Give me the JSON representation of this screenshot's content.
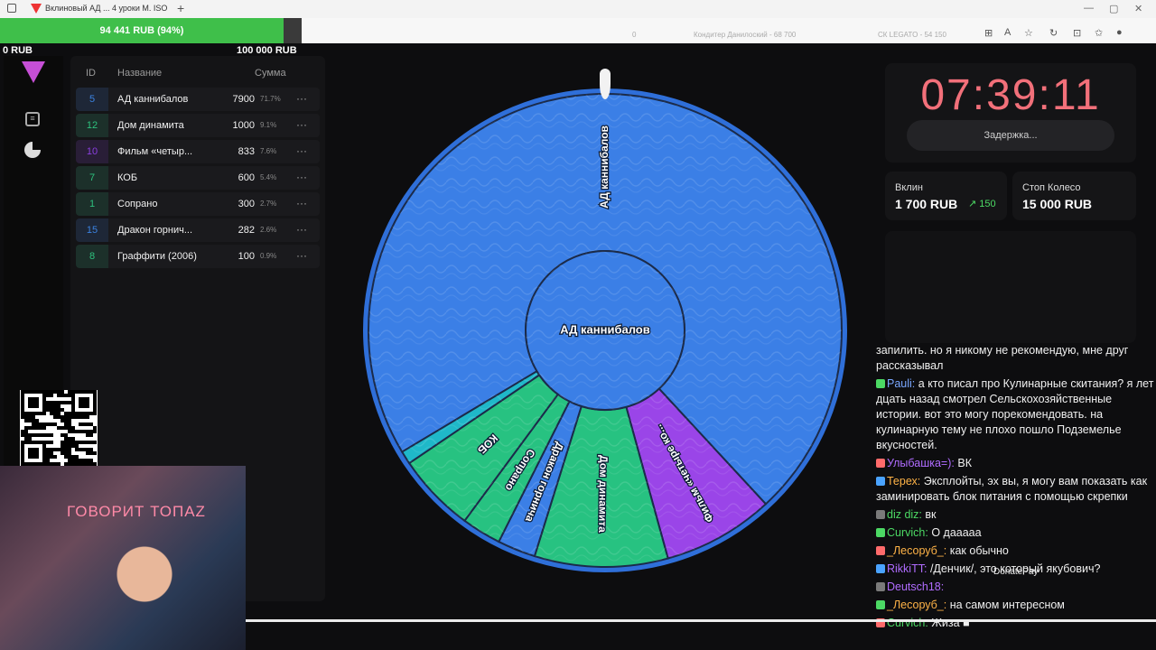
{
  "browser": {
    "title": "Вклиновый АД ... 4 уроки М. ISO",
    "plus": "+",
    "address_items": [
      "0",
      "Кондитер Данилоский - 68 700",
      "СК LEGATO - 54 150"
    ]
  },
  "goal": {
    "current_label": "94 441 RUB (94%)",
    "min_label": "0 RUB",
    "max_label": "100 000 RUB",
    "progress": 0.94
  },
  "sidebar": {
    "list_icon": "list-icon",
    "pie_icon": "pie-chart-icon",
    "logo": "logo-triangle-icon"
  },
  "table": {
    "headers": {
      "id": "ID",
      "name": "Название",
      "sum": "Сумма"
    },
    "rows": [
      {
        "id": "5",
        "name": "АД каннибалов",
        "sum": "7900",
        "pct": "71.7%",
        "color": "#3b82e0"
      },
      {
        "id": "12",
        "name": "Дом динамита",
        "sum": "1000",
        "pct": "9.1%",
        "color": "#2ec27e"
      },
      {
        "id": "10",
        "name": "Фильм «четыр...",
        "sum": "833",
        "pct": "7.6%",
        "color": "#8b3fe0"
      },
      {
        "id": "7",
        "name": "КОБ",
        "sum": "600",
        "pct": "5.4%",
        "color": "#2ec27e"
      },
      {
        "id": "1",
        "name": "Сопрано",
        "sum": "300",
        "pct": "2.7%",
        "color": "#2ec27e"
      },
      {
        "id": "15",
        "name": "Дракон горнич...",
        "sum": "282",
        "pct": "2.6%",
        "color": "#3b82e0"
      },
      {
        "id": "8",
        "name": "Граффити (2006)",
        "sum": "100",
        "pct": "0.9%",
        "color": "#2ec27e"
      }
    ],
    "more": "···"
  },
  "wheel": {
    "center_label": "АД каннибалов",
    "segments": [
      {
        "label": "АД каннибалов",
        "share": 0.717,
        "color": "#3b7fe6"
      },
      {
        "label": "Фильм «четыре ко...",
        "share": 0.076,
        "color": "#9a45e8"
      },
      {
        "label": "Дом динамита",
        "share": 0.091,
        "color": "#27c281"
      },
      {
        "label": "Дракон горнича",
        "share": 0.026,
        "color": "#3b7fe6"
      },
      {
        "label": "Сопрано",
        "share": 0.027,
        "color": "#27c281"
      },
      {
        "label": "КОБ",
        "share": 0.054,
        "color": "#27c281"
      },
      {
        "label": "",
        "share": 0.009,
        "color": "#1fb8c9"
      }
    ]
  },
  "timer": {
    "value": "07:39:11",
    "delay_label": "Задержка..."
  },
  "stats": {
    "insert": {
      "label": "Вклин",
      "value": "1 700 RUB",
      "delta": "150"
    },
    "stop": {
      "label": "Стоп Колесо",
      "value": "15 000 RUB"
    }
  },
  "chat": [
    {
      "user": "",
      "user_color": "#ffffff",
      "text": "запилить. но я никому не рекомендую, мне друг рассказывал"
    },
    {
      "user": "Pauli:",
      "user_color": "#7aa7ff",
      "text": "а кто писал про Кулинарные скитания? я лет дцать назад смотрел Сельскохозяйственные истории. вот это могу порекомендовать. на кулинарную тему не плохо пошло Подземелье вкусностей."
    },
    {
      "user": "Улыбашка=):",
      "user_color": "#b06cff",
      "text": "ВК"
    },
    {
      "user": "Терех:",
      "user_color": "#ffb347",
      "text": "Эксплойты, эх вы, я могу вам показать как заминировать блок питания с помощью скрепки"
    },
    {
      "user": "diz diz:",
      "user_color": "#4cd964",
      "text": "вк"
    },
    {
      "user": "Curvich:",
      "user_color": "#4cd964",
      "text": "О даааaa"
    },
    {
      "user": "_Лесоруб_:",
      "user_color": "#ffb347",
      "text": "как обычно"
    },
    {
      "user": "RikkiTT:",
      "user_color": "#b06cff",
      "text": "/Денчик/, это который якубович?"
    },
    {
      "user": "Deutsch18:",
      "user_color": "#b06cff",
      "text": ""
    },
    {
      "user": "_Лесоруб_:",
      "user_color": "#ffb347",
      "text": "на самом интересном"
    },
    {
      "user": "Curvich:",
      "user_color": "#4cd964",
      "text": "Жиза ■"
    }
  ],
  "overlay": {
    "cam_text": "ГОВОРИТ ТОПАZ",
    "donate": "DonatePay"
  }
}
